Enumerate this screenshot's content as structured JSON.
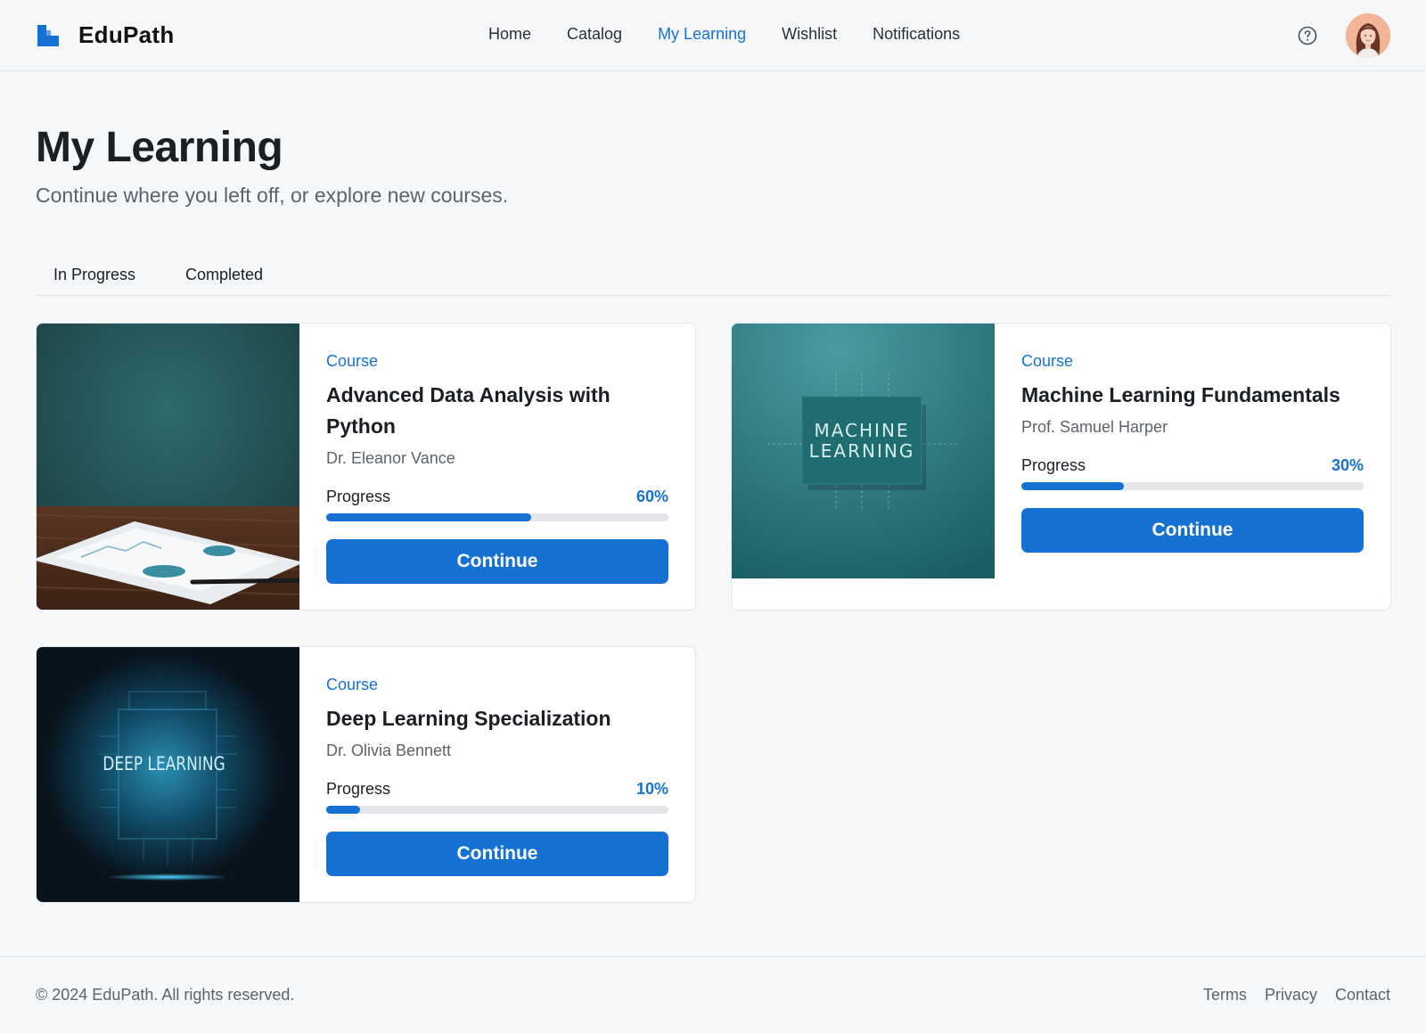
{
  "brand": {
    "name": "EduPath",
    "accent": "#1572d3"
  },
  "nav": {
    "items": [
      {
        "label": "Home"
      },
      {
        "label": "Catalog"
      },
      {
        "label": "My Learning"
      },
      {
        "label": "Wishlist"
      },
      {
        "label": "Notifications"
      }
    ],
    "active": "My Learning"
  },
  "header": {
    "help_icon": "help-circle-icon",
    "avatar": "user-avatar"
  },
  "page": {
    "title": "My Learning",
    "subtitle": "Continue where you left off, or explore new courses."
  },
  "tabs": [
    {
      "label": "In Progress"
    },
    {
      "label": "Completed"
    }
  ],
  "courses": [
    {
      "kind": "Course",
      "title": "Advanced Data Analysis with Python",
      "instructor": "Dr. Eleanor Vance",
      "progress_label": "Progress",
      "progress_text": "60%",
      "progress": 0.6,
      "button": "Continue"
    },
    {
      "kind": "Course",
      "title": "Machine Learning Fundamentals",
      "instructor": "Prof. Samuel Harper",
      "progress_label": "Progress",
      "progress_text": "30%",
      "progress": 0.3,
      "button": "Continue",
      "thumb_text": [
        "MACHINE",
        "LEARNING"
      ]
    },
    {
      "kind": "Course",
      "title": "Deep Learning Specialization",
      "instructor": "Dr. Olivia Bennett",
      "progress_label": "Progress",
      "progress_text": "10%",
      "progress": 0.1,
      "button": "Continue",
      "thumb_text": "DEEP LEARNING"
    }
  ],
  "footer": {
    "copyright": "© 2024 EduPath. All rights reserved.",
    "links": [
      {
        "label": "Terms"
      },
      {
        "label": "Privacy"
      },
      {
        "label": "Contact"
      }
    ]
  }
}
